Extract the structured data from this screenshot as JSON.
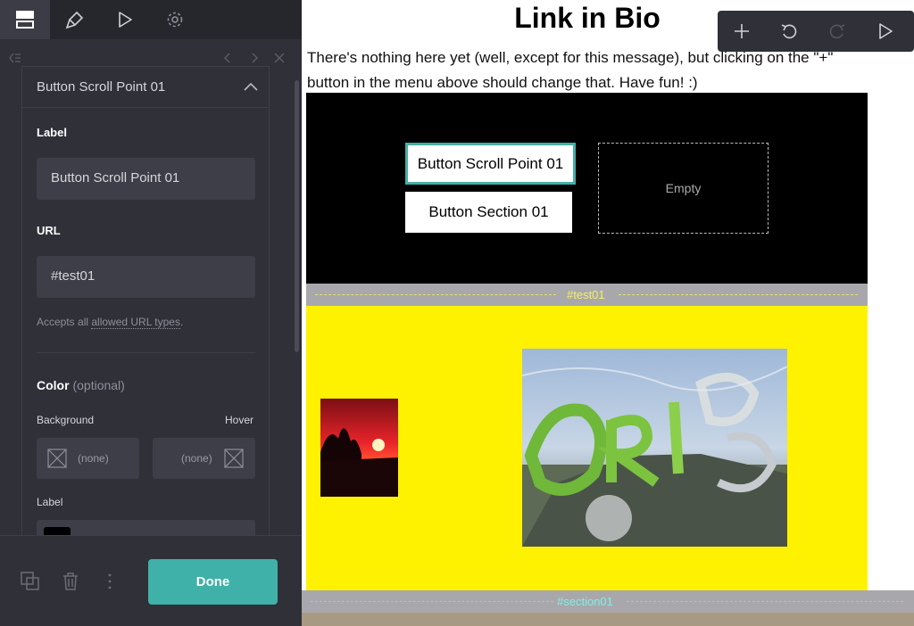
{
  "sidebar": {
    "tabs": [
      {
        "name": "layout",
        "icon": "layout-icon",
        "active": true
      },
      {
        "name": "style",
        "icon": "brush-icon",
        "active": false
      },
      {
        "name": "preview",
        "icon": "play-icon",
        "active": false
      },
      {
        "name": "settings",
        "icon": "gear-icon",
        "active": false
      }
    ],
    "panel": {
      "title": "Button Scroll Point 01",
      "label_field": {
        "label": "Label",
        "value": "Button Scroll Point 01"
      },
      "url_field": {
        "label": "URL",
        "value": "#test01"
      },
      "hint_prefix": "Accepts all ",
      "hint_link": "allowed URL types",
      "hint_suffix": ".",
      "color": {
        "title": "Color",
        "optional": "(optional)",
        "background_label": "Background",
        "hover_label": "Hover",
        "background_value": "(none)",
        "hover_value": "(none)",
        "label_label": "Label"
      }
    },
    "footer": {
      "done_label": "Done"
    }
  },
  "content": {
    "title": "Link in Bio",
    "intro": "There's nothing here yet (well, except for this message), but clicking on the \"+\" button in the menu above should change that. Have fun! :)",
    "buttons": {
      "scroll_point": "Button Scroll Point 01",
      "section": "Button Section 01"
    },
    "empty_label": "Empty",
    "anchors": {
      "test": "#test01",
      "section": "#section01"
    }
  },
  "colors": {
    "accent": "#3fb1a8",
    "sidebar_bg": "#2f3038",
    "section_black": "#000000",
    "section_yellow": "#fff200"
  }
}
